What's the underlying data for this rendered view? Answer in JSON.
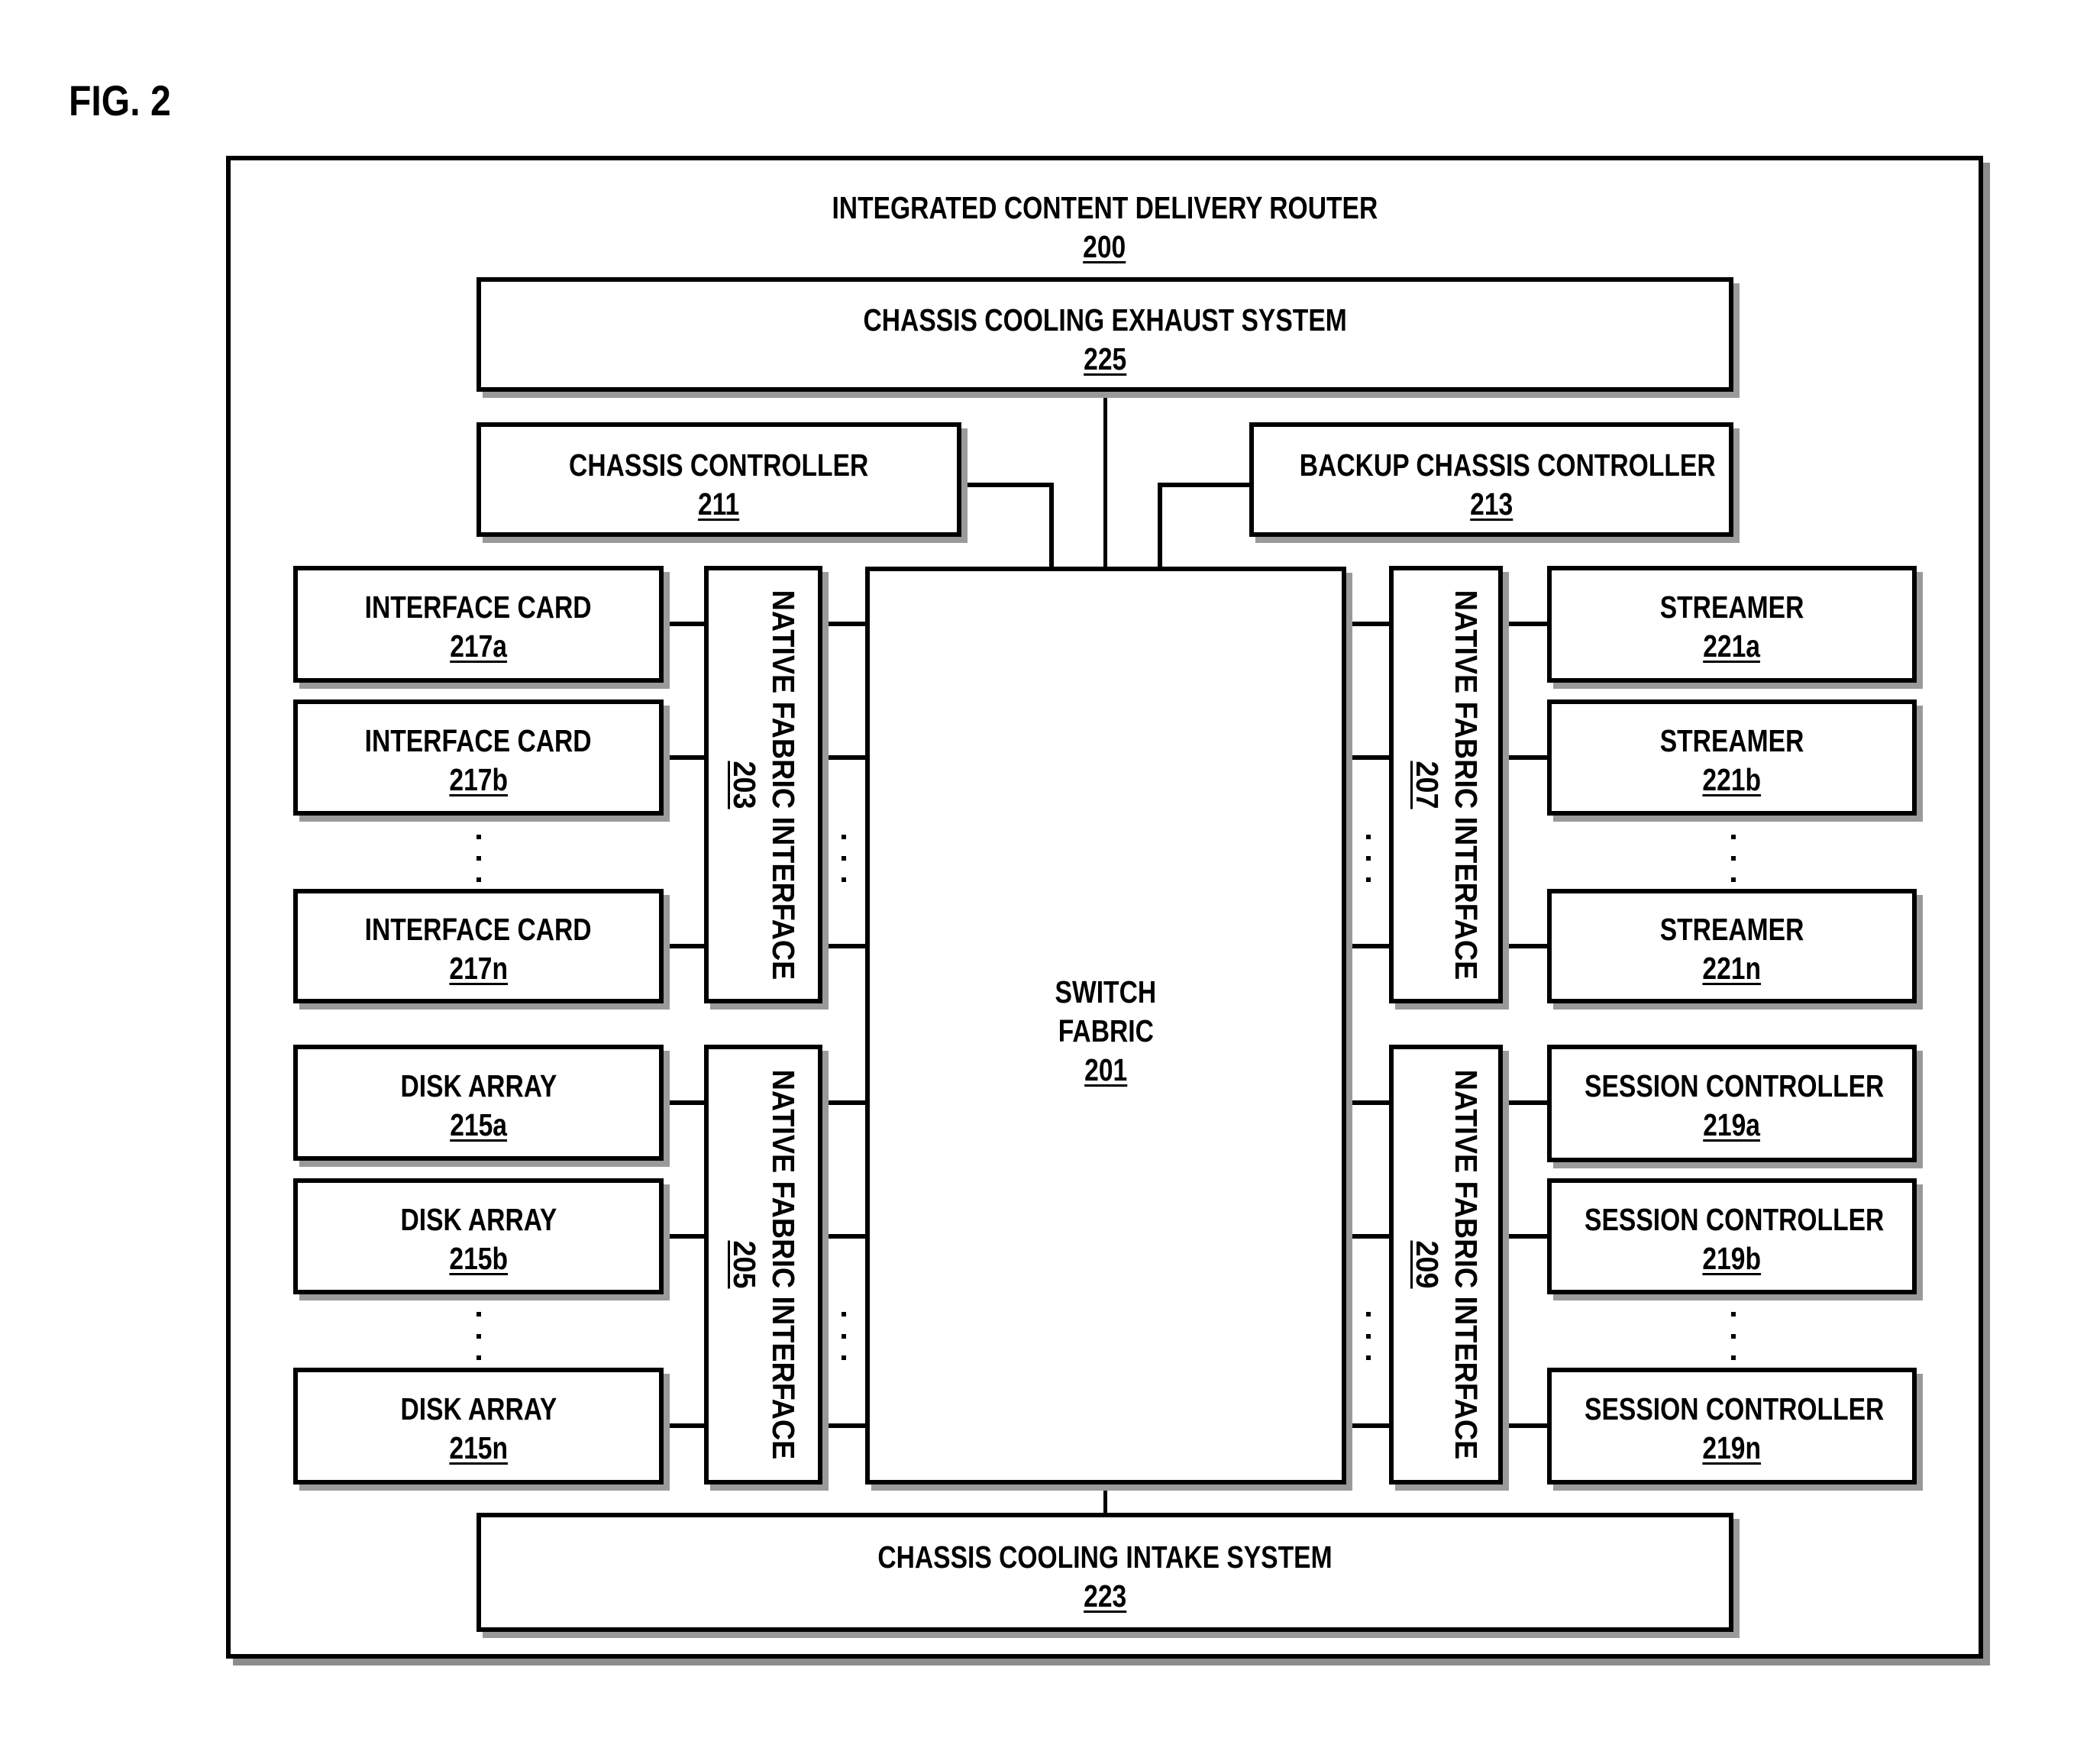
{
  "figure_label": "FIG. 2",
  "router": {
    "title": "INTEGRATED CONTENT DELIVERY ROUTER",
    "ref": "200"
  },
  "exhaust": {
    "title": "CHASSIS COOLING EXHAUST SYSTEM",
    "ref": "225"
  },
  "intake": {
    "title": "CHASSIS COOLING INTAKE SYSTEM",
    "ref": "223"
  },
  "chassis_controller": {
    "title": "CHASSIS CONTROLLER",
    "ref": "211"
  },
  "backup_controller": {
    "title": "BACKUP CHASSIS CONTROLLER",
    "ref": "213"
  },
  "switch_fabric": {
    "line1": "SWITCH",
    "line2": "FABRIC",
    "ref": "201"
  },
  "nfi": [
    {
      "title": "NATIVE FABRIC INTERFACE",
      "ref": "203"
    },
    {
      "title": "NATIVE FABRIC INTERFACE",
      "ref": "205"
    },
    {
      "title": "NATIVE FABRIC INTERFACE",
      "ref": "207"
    },
    {
      "title": "NATIVE FABRIC INTERFACE",
      "ref": "209"
    }
  ],
  "interface_cards": [
    {
      "title": "INTERFACE CARD",
      "ref": "217a"
    },
    {
      "title": "INTERFACE CARD",
      "ref": "217b"
    },
    {
      "title": "INTERFACE CARD",
      "ref": "217n"
    }
  ],
  "disk_arrays": [
    {
      "title": "DISK ARRAY",
      "ref": "215a"
    },
    {
      "title": "DISK ARRAY",
      "ref": "215b"
    },
    {
      "title": "DISK ARRAY",
      "ref": "215n"
    }
  ],
  "streamers": [
    {
      "title": "STREAMER",
      "ref": "221a"
    },
    {
      "title": "STREAMER",
      "ref": "221b"
    },
    {
      "title": "STREAMER",
      "ref": "221n"
    }
  ],
  "session_controllers": [
    {
      "title": "SESSION CONTROLLER",
      "ref": "219a"
    },
    {
      "title": "SESSION CONTROLLER",
      "ref": "219b"
    },
    {
      "title": "SESSION CONTROLLER",
      "ref": "219n"
    }
  ],
  "ellipsis": "…"
}
